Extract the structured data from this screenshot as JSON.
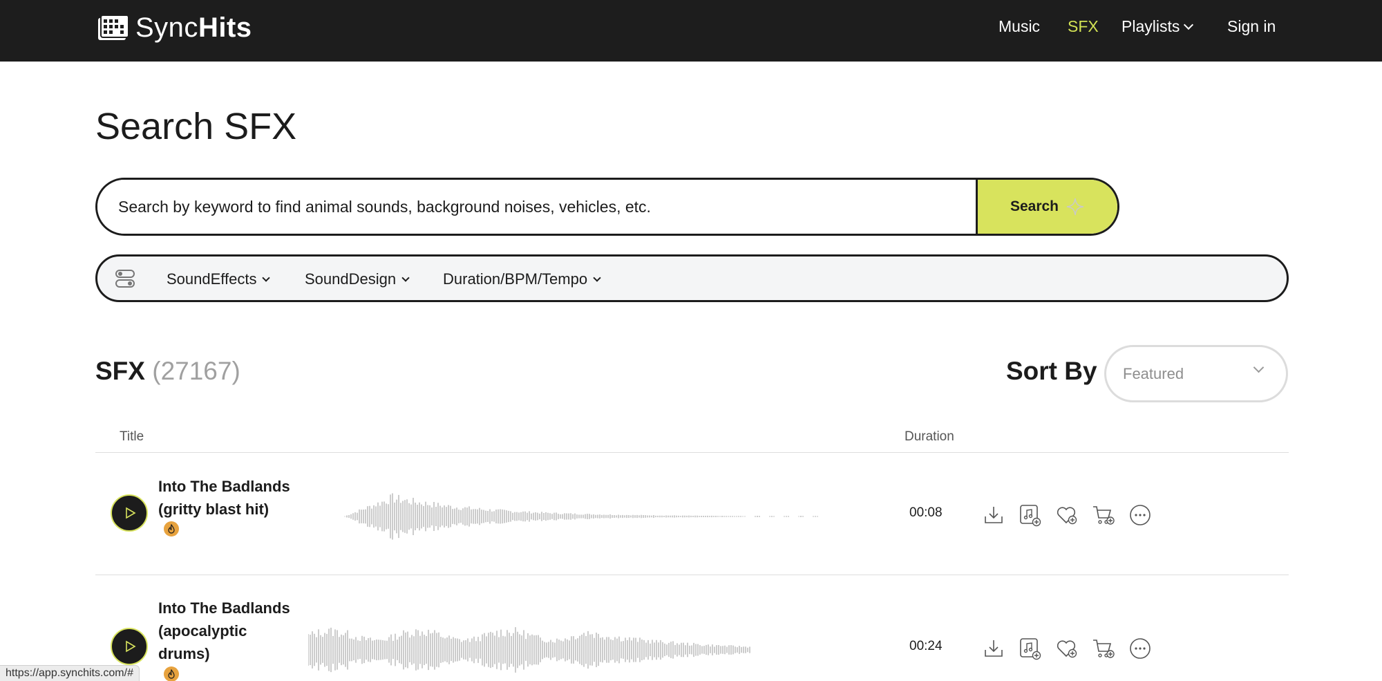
{
  "brand": {
    "name_light": "Sync",
    "name_bold": "Hits",
    "logo_icon": "music-box-logo-icon"
  },
  "nav": {
    "music": "Music",
    "sfx": "SFX",
    "playlists": "Playlists",
    "sign_in": "Sign in"
  },
  "page": {
    "title": "Search SFX"
  },
  "search": {
    "placeholder": "Search by keyword to find animal sounds, background noises, vehicles, etc.",
    "button_label": "Search"
  },
  "filters": {
    "items": [
      "SoundEffects",
      "SoundDesign",
      "Duration/BPM/Tempo"
    ]
  },
  "results": {
    "label": "SFX",
    "count": "(27167)"
  },
  "sort": {
    "label": "Sort By",
    "selected": "Featured"
  },
  "table": {
    "columns": {
      "title": "Title",
      "duration": "Duration"
    },
    "rows": [
      {
        "title": "Into The Badlands (gritty blast hit)",
        "title_lines": [
          "Into The Badlands",
          "(gritty blast hit)"
        ],
        "duration": "00:08",
        "badge_icon": "flame-icon"
      },
      {
        "title": "Into The Badlands (apocalyptic drums)",
        "title_lines": [
          "Into The Badlands",
          "(apocalyptic",
          "drums)"
        ],
        "duration": "00:24",
        "badge_icon": "flame-icon"
      }
    ],
    "action_icons": [
      "download-icon",
      "add-to-playlist-icon",
      "favorite-icon",
      "add-to-cart-icon",
      "more-icon"
    ]
  },
  "status_bar": {
    "url": "https://app.synchits.com/#"
  },
  "colors": {
    "accent": "#d8e35d",
    "nav_active": "#d2e254",
    "topbar": "#1d1d1d",
    "badge": "#e7a23e"
  }
}
